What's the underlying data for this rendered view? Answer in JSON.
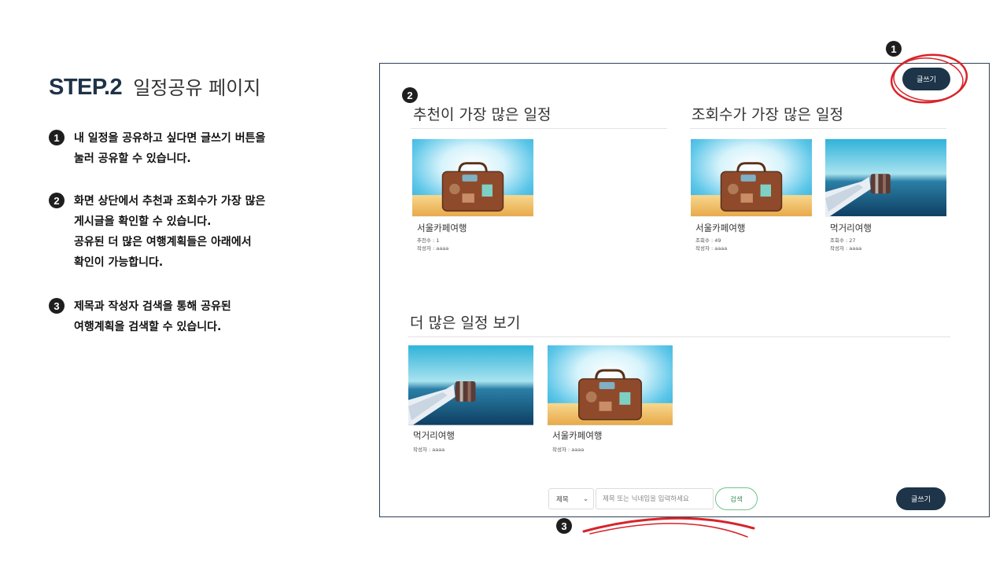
{
  "guide": {
    "step_label": "STEP.2",
    "step_subtitle": "일정공유 페이지",
    "items": [
      {
        "num": "1",
        "lines": [
          "내 일정을 공유하고 싶다면 글쓰기 버튼을",
          "눌러 공유할 수 있습니다."
        ]
      },
      {
        "num": "2",
        "lines": [
          "화면 상단에서 추천과 조회수가 가장 많은",
          "게시글을 확인할 수 있습니다.",
          "공유된 더 많은 여행계획들은 아래에서",
          "확인이 가능합니다."
        ]
      },
      {
        "num": "3",
        "lines": [
          "제목과 작성자 검색을 통해 공유된",
          "여행계획을 검색할 수 있습니다."
        ]
      }
    ]
  },
  "markers": {
    "m1": "1",
    "m2": "2",
    "m3": "3"
  },
  "screen": {
    "write_button_top": "글쓰기",
    "write_button_bottom": "글쓰기",
    "most_recommended": {
      "title": "추천이 가장 많은 일정",
      "cards": [
        {
          "name": "서울카페여행",
          "stat": "추천수 : 1",
          "author": "작성자 : aaaa",
          "image": "suitcase"
        }
      ]
    },
    "most_viewed": {
      "title": "조회수가 가장 많은 일정",
      "cards": [
        {
          "name": "서울카페여행",
          "stat": "조회수 : 49",
          "author": "작성자 : aaaa",
          "image": "suitcase"
        },
        {
          "name": "먹거리여행",
          "stat": "조회수 : 27",
          "author": "작성자 : aaaa",
          "image": "sea-mug"
        }
      ]
    },
    "more": {
      "title": "더 많은 일정 보기",
      "cards": [
        {
          "name": "먹거리여행",
          "author": "작성자 : aaaa",
          "image": "sea-mug"
        },
        {
          "name": "서울카페여행",
          "author": "작성자 : aaaa",
          "image": "suitcase"
        }
      ]
    },
    "search": {
      "select_value": "제목",
      "placeholder": "제목 또는 닉네임을 입력하세요",
      "button": "검색"
    }
  },
  "colors": {
    "navy": "#1d3449",
    "highlight_red": "#d8232a",
    "search_green": "#71c48a"
  }
}
